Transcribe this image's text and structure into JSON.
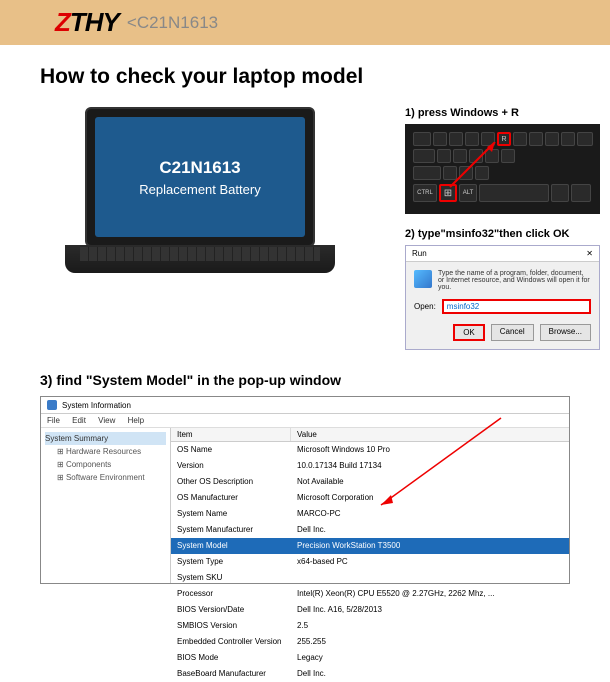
{
  "header": {
    "brand_prefix": "Z",
    "brand_rest": "THY",
    "model": "C21N1613"
  },
  "title": "How to check your laptop model",
  "laptop_screen": {
    "line1": "C21N1613",
    "line2": "Replacement Battery"
  },
  "steps": {
    "s1": "1)  press Windows + R",
    "s2": "2)  type\"msinfo32\"then click OK",
    "s3": "3) find \"System Model\" in the pop-up window"
  },
  "keyboard": {
    "windows_key": "⊞",
    "r_key": "R",
    "ctrl": "CTRL",
    "alt": "ALT"
  },
  "run": {
    "title": "Run",
    "close": "✕",
    "desc": "Type the name of a program, folder, document, or Internet resource, and Windows will open it for you.",
    "open_label": "Open:",
    "input_value": "msinfo32",
    "ok": "OK",
    "cancel": "Cancel",
    "browse": "Browse..."
  },
  "sysinfo": {
    "window_title": "System Information",
    "menu": {
      "file": "File",
      "edit": "Edit",
      "view": "View",
      "help": "Help"
    },
    "tree": {
      "root": "System Summary",
      "hw": "Hardware Resources",
      "comp": "Components",
      "sw": "Software Environment"
    },
    "headers": {
      "item": "Item",
      "value": "Value"
    },
    "rows": [
      {
        "k": "OS Name",
        "v": "Microsoft Windows 10 Pro"
      },
      {
        "k": "Version",
        "v": "10.0.17134 Build 17134"
      },
      {
        "k": "Other OS Description",
        "v": "Not Available"
      },
      {
        "k": "OS Manufacturer",
        "v": "Microsoft Corporation"
      },
      {
        "k": "System Name",
        "v": "MARCO-PC"
      },
      {
        "k": "System Manufacturer",
        "v": "Dell Inc."
      },
      {
        "k": "System Model",
        "v": "Precision WorkStation T3500",
        "hl": true
      },
      {
        "k": "System Type",
        "v": "x64-based PC"
      },
      {
        "k": "System SKU",
        "v": ""
      },
      {
        "k": "Processor",
        "v": "Intel(R) Xeon(R) CPU        E5520  @ 2.27GHz, 2262 Mhz, ..."
      },
      {
        "k": "BIOS Version/Date",
        "v": "Dell Inc. A16, 5/28/2013"
      },
      {
        "k": "SMBIOS Version",
        "v": "2.5"
      },
      {
        "k": "Embedded Controller Version",
        "v": "255.255"
      },
      {
        "k": "BIOS Mode",
        "v": "Legacy"
      },
      {
        "k": "BaseBoard Manufacturer",
        "v": "Dell Inc."
      }
    ]
  }
}
